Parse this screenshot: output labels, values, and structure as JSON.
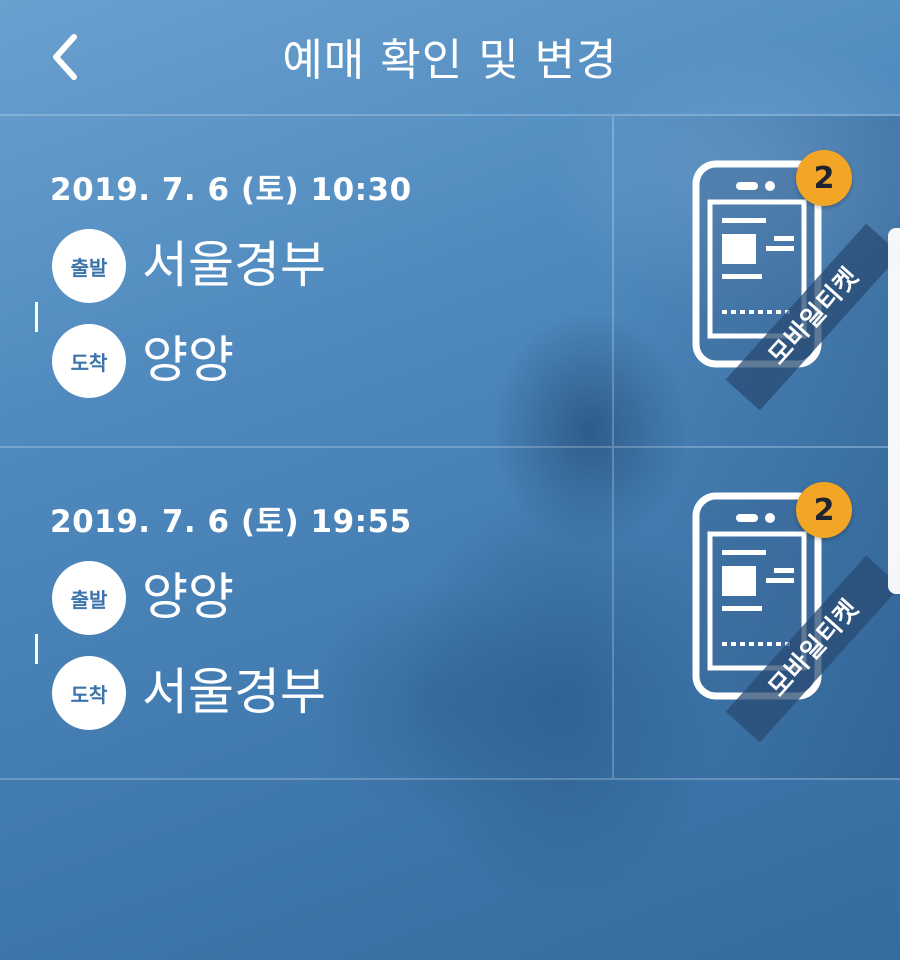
{
  "header": {
    "title": "예매 확인 및 변경",
    "back_icon": "chevron-left-icon"
  },
  "labels": {
    "departure": "출발",
    "arrival": "도착",
    "mobile_ticket": "모바일티켓"
  },
  "reservations": [
    {
      "datetime": "2019. 7. 6 (토) 10:30",
      "departure": "서울경부",
      "arrival": "양양",
      "ticket_count": "2"
    },
    {
      "datetime": "2019. 7. 6 (토) 19:55",
      "departure": "양양",
      "arrival": "서울경부",
      "ticket_count": "2"
    }
  ],
  "colors": {
    "accent_badge": "#f3a625",
    "background": "#4f89bd"
  }
}
